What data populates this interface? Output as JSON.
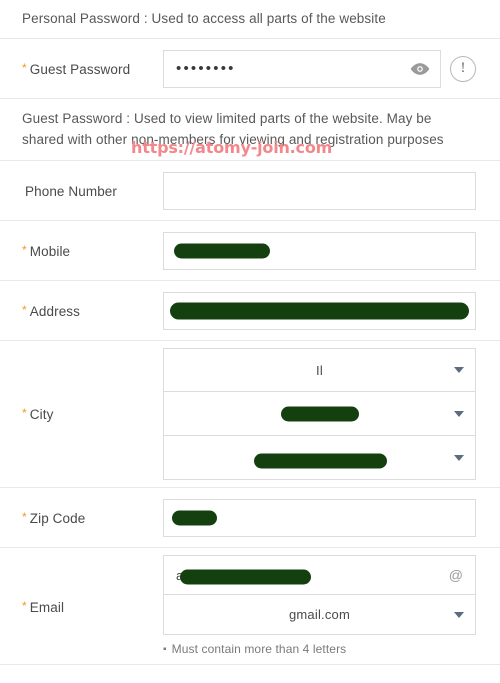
{
  "notes": {
    "personal_password": "Personal Password : Used to access all parts of the website",
    "guest_password": "Guest Password : Used to view limited parts of the website. May be shared with other non-members for viewing and registration purposes"
  },
  "watermark": {
    "text": "https://atomy-join.com",
    "color": "#f2888c"
  },
  "colors": {
    "required_asterisk": "#f59a23",
    "redaction": "#14400f",
    "border": "#dcdcdc",
    "divider": "#e8e8e8",
    "caret": "#5b6b80"
  },
  "fields": {
    "guest_password": {
      "label": "Guest Password",
      "required_mark": "*",
      "value": "••••••••",
      "placeholder": "",
      "eye_icon": "eye-icon",
      "warning_icon": "!"
    },
    "phone_number": {
      "label": "Phone Number",
      "required_mark": "",
      "value": "",
      "placeholder": ""
    },
    "mobile": {
      "label": "Mobile",
      "required_mark": "*",
      "value": "",
      "placeholder": ""
    },
    "address": {
      "label": "Address",
      "required_mark": "*",
      "value": "",
      "placeholder": ""
    },
    "city": {
      "label": "City",
      "required_mark": "*",
      "selects": [
        {
          "value": "Il"
        },
        {
          "value": ""
        },
        {
          "value": ""
        }
      ]
    },
    "zip_code": {
      "label": "Zip Code",
      "required_mark": "*",
      "value": "",
      "placeholder": ""
    },
    "email": {
      "label": "Email",
      "required_mark": "*",
      "local_part": "a",
      "at_symbol": "@",
      "domain": "gmail.com",
      "hint_bullet": "▪",
      "hint": "Must contain more than 4 letters"
    }
  }
}
